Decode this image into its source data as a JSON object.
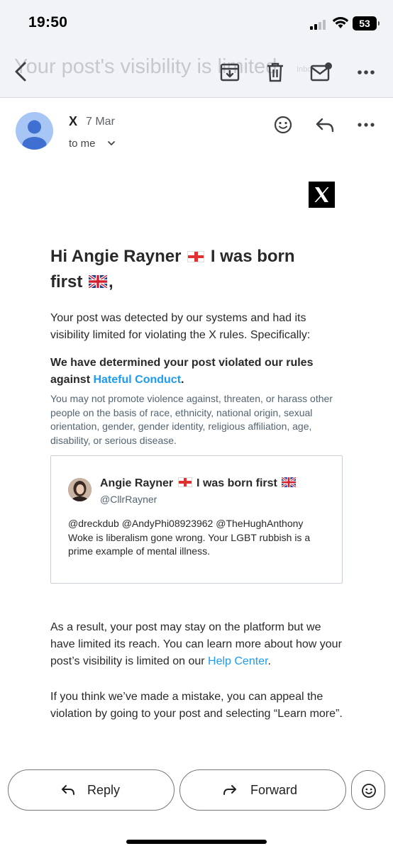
{
  "status_bar": {
    "time": "19:50",
    "battery": "53"
  },
  "toolbar": {
    "subject_ghost": "Your post's visibility is limited",
    "badge_ghost": "Inbox",
    "icons": [
      "back-arrow-icon",
      "archive-icon",
      "delete-icon",
      "mark-unread-icon",
      "more-icon"
    ]
  },
  "email": {
    "sender": "X",
    "date": "7 Mar",
    "recipient": "to me",
    "heading_line1_a": "Hi Angie Rayner",
    "heading_line1_b": "I was born",
    "heading_line2": "first",
    "heading_line2_end": ",",
    "intro": "Your post was detected by our systems and had its visibility limited for violating the X rules. Specifically:",
    "determined_prefix": "We have determined your post violated our rules against ",
    "determined_link": "Hateful Conduct",
    "determined_suffix": ".",
    "policy_text": "You may not promote violence against, threaten, or harass other people on the basis of race, ethnicity, national origin, sexual orientation, gender, gender identity, religious affiliation, age, disability, or serious disease.",
    "post": {
      "name_a": "Angie Rayner",
      "name_b": "I was born first",
      "handle": "@CllrRayner",
      "text": "@dreckdub @AndyPhi08923962 @TheHughAnthony Woke is liberalism gone wrong. Your LGBT rubbish is a prime example of mental illness."
    },
    "result_prefix": "As a result, your post may stay on the platform but we have limited its reach. You can learn more about how your post’s visibility is limited on our ",
    "result_link": "Help Center",
    "result_suffix": ".",
    "appeal": "If you think we’ve made a mistake, you can appeal the violation by going to your post and selecting “Learn more”."
  },
  "actions": {
    "reply": "Reply",
    "forward": "Forward"
  },
  "colors": {
    "link": "#1d9bf0",
    "toolbar_bg": "#f1f3f6",
    "avatar": "#a7c5f5"
  }
}
